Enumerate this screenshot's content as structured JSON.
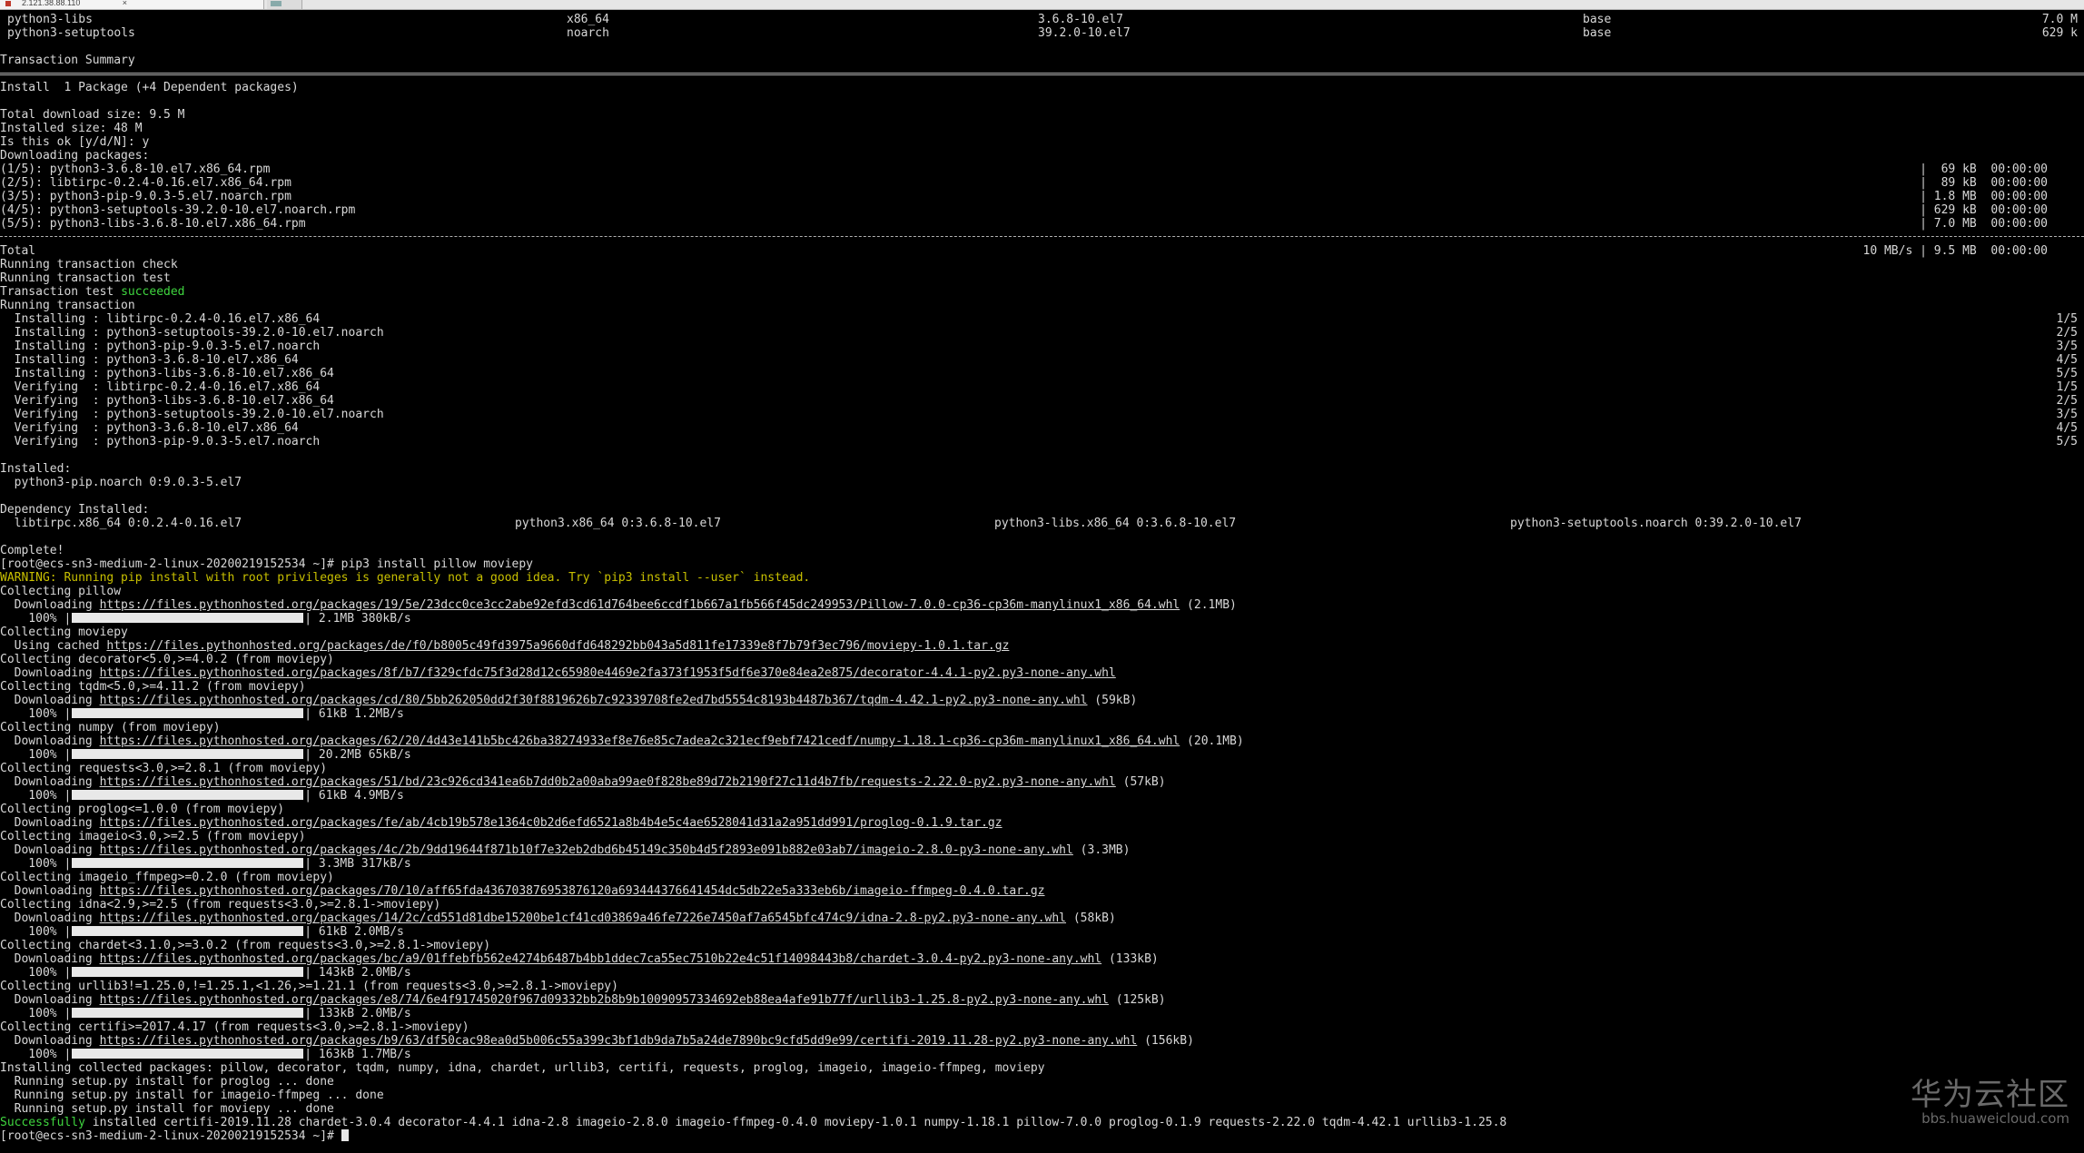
{
  "tabs": [
    {
      "title": "2.121.38.88.110",
      "active": true
    },
    {
      "title": "",
      "active": false
    }
  ],
  "pkg_table": [
    {
      "name": "python3-libs",
      "arch": "x86_64",
      "version": "3.6.8-10.el7",
      "repo": "base",
      "size": "7.0 M"
    },
    {
      "name": "python3-setuptools",
      "arch": "noarch",
      "version": "39.2.0-10.el7",
      "repo": "base",
      "size": "629 k"
    }
  ],
  "summary": {
    "title": "Transaction Summary",
    "install_line": "Install  1 Package (+4 Dependent packages)",
    "download_size": "Total download size: 9.5 M",
    "installed_size": "Installed size: 48 M",
    "prompt": "Is this ok [y/d/N]: y",
    "downloading": "Downloading packages:"
  },
  "downloads": [
    {
      "name": "(1/5): python3-3.6.8-10.el7.x86_64.rpm",
      "stat": "|  69 kB  00:00:00"
    },
    {
      "name": "(2/5): libtirpc-0.2.4-0.16.el7.x86_64.rpm",
      "stat": "|  89 kB  00:00:00"
    },
    {
      "name": "(3/5): python3-pip-9.0.3-5.el7.noarch.rpm",
      "stat": "| 1.8 MB  00:00:00"
    },
    {
      "name": "(4/5): python3-setuptools-39.2.0-10.el7.noarch.rpm",
      "stat": "| 629 kB  00:00:00"
    },
    {
      "name": "(5/5): python3-libs-3.6.8-10.el7.x86_64.rpm",
      "stat": "| 7.0 MB  00:00:00"
    }
  ],
  "total": {
    "label": "Total",
    "stat": "10 MB/s | 9.5 MB  00:00:00"
  },
  "check": [
    "Running transaction check",
    "Running transaction test"
  ],
  "test_prefix": "Transaction test ",
  "test_status": "succeeded",
  "running": "Running transaction",
  "steps": [
    {
      "text": "  Installing : libtirpc-0.2.4-0.16.el7.x86_64",
      "n": "1/5"
    },
    {
      "text": "  Installing : python3-setuptools-39.2.0-10.el7.noarch",
      "n": "2/5"
    },
    {
      "text": "  Installing : python3-pip-9.0.3-5.el7.noarch",
      "n": "3/5"
    },
    {
      "text": "  Installing : python3-3.6.8-10.el7.x86_64",
      "n": "4/5"
    },
    {
      "text": "  Installing : python3-libs-3.6.8-10.el7.x86_64",
      "n": "5/5"
    },
    {
      "text": "  Verifying  : libtirpc-0.2.4-0.16.el7.x86_64",
      "n": "1/5"
    },
    {
      "text": "  Verifying  : python3-libs-3.6.8-10.el7.x86_64",
      "n": "2/5"
    },
    {
      "text": "  Verifying  : python3-setuptools-39.2.0-10.el7.noarch",
      "n": "3/5"
    },
    {
      "text": "  Verifying  : python3-3.6.8-10.el7.x86_64",
      "n": "4/5"
    },
    {
      "text": "  Verifying  : python3-pip-9.0.3-5.el7.noarch",
      "n": "5/5"
    }
  ],
  "installed": {
    "label": "Installed:",
    "item": "  python3-pip.noarch 0:9.0.3-5.el7"
  },
  "deps": {
    "label": "Dependency Installed:",
    "items": [
      "  libtirpc.x86_64 0:0.2.4-0.16.el7",
      "python3.x86_64 0:3.6.8-10.el7",
      "python3-libs.x86_64 0:3.6.8-10.el7",
      "python3-setuptools.noarch 0:39.2.0-10.el7"
    ]
  },
  "complete": "Complete!",
  "prompt1": "[root@ecs-sn3-medium-2-linux-20200219152534 ~]# pip3 install pillow moviepy",
  "warning": "WARNING: Running pip install with root privileges is generally not a good idea. Try `pip3 install --user` instead.",
  "pip_lines": [
    {
      "t": "text",
      "text": "Collecting pillow"
    },
    {
      "t": "dl",
      "prefix": "  Downloading ",
      "url": "https://files.pythonhosted.org/packages/19/5e/23dcc0ce3cc2abe92efd3cd61d764bee6ccdf1b667a1fb566f45dc249953/Pillow-7.0.0-cp36-cp36m-manylinux1_x86_64.whl",
      "suffix": " (2.1MB)"
    },
    {
      "t": "bar",
      "pct": "    100% |",
      "after": "| 2.1MB 380kB/s"
    },
    {
      "t": "text",
      "text": "Collecting moviepy"
    },
    {
      "t": "dl",
      "prefix": "  Using cached ",
      "url": "https://files.pythonhosted.org/packages/de/f0/b8005c49fd3975a9660dfd648292bb043a5d811fe17339e8f7b79f3ec796/moviepy-1.0.1.tar.gz",
      "suffix": ""
    },
    {
      "t": "text",
      "text": "Collecting decorator<5.0,>=4.0.2 (from moviepy)"
    },
    {
      "t": "dl",
      "prefix": "  Downloading ",
      "url": "https://files.pythonhosted.org/packages/8f/b7/f329cfdc75f3d28d12c65980e4469e2fa373f1953f5df6e370e84ea2e875/decorator-4.4.1-py2.py3-none-any.whl",
      "suffix": ""
    },
    {
      "t": "text",
      "text": "Collecting tqdm<5.0,>=4.11.2 (from moviepy)"
    },
    {
      "t": "dl",
      "prefix": "  Downloading ",
      "url": "https://files.pythonhosted.org/packages/cd/80/5bb262050dd2f30f8819626b7c92339708fe2ed7bd5554c8193b4487b367/tqdm-4.42.1-py2.py3-none-any.whl",
      "suffix": " (59kB)"
    },
    {
      "t": "bar",
      "pct": "    100% |",
      "after": "| 61kB 1.2MB/s"
    },
    {
      "t": "text",
      "text": "Collecting numpy (from moviepy)"
    },
    {
      "t": "dl",
      "prefix": "  Downloading ",
      "url": "https://files.pythonhosted.org/packages/62/20/4d43e141b5bc426ba38274933ef8e76e85c7adea2c321ecf9ebf7421cedf/numpy-1.18.1-cp36-cp36m-manylinux1_x86_64.whl",
      "suffix": " (20.1MB)"
    },
    {
      "t": "bar",
      "pct": "    100% |",
      "after": "| 20.2MB 65kB/s"
    },
    {
      "t": "text",
      "text": "Collecting requests<3.0,>=2.8.1 (from moviepy)"
    },
    {
      "t": "dl",
      "prefix": "  Downloading ",
      "url": "https://files.pythonhosted.org/packages/51/bd/23c926cd341ea6b7dd0b2a00aba99ae0f828be89d72b2190f27c11d4b7fb/requests-2.22.0-py2.py3-none-any.whl",
      "suffix": " (57kB)"
    },
    {
      "t": "bar",
      "pct": "    100% |",
      "after": "| 61kB 4.9MB/s"
    },
    {
      "t": "text",
      "text": "Collecting proglog<=1.0.0 (from moviepy)"
    },
    {
      "t": "dl",
      "prefix": "  Downloading ",
      "url": "https://files.pythonhosted.org/packages/fe/ab/4cb19b578e1364c0b2d6efd6521a8b4b4e5c4ae6528041d31a2a951dd991/proglog-0.1.9.tar.gz",
      "suffix": ""
    },
    {
      "t": "text",
      "text": "Collecting imageio<3.0,>=2.5 (from moviepy)"
    },
    {
      "t": "dl",
      "prefix": "  Downloading ",
      "url": "https://files.pythonhosted.org/packages/4c/2b/9dd19644f871b10f7e32eb2dbd6b45149c350b4d5f2893e091b882e03ab7/imageio-2.8.0-py3-none-any.whl",
      "suffix": " (3.3MB)"
    },
    {
      "t": "bar",
      "pct": "    100% |",
      "after": "| 3.3MB 317kB/s"
    },
    {
      "t": "text",
      "text": "Collecting imageio_ffmpeg>=0.2.0 (from moviepy)"
    },
    {
      "t": "dl",
      "prefix": "  Downloading ",
      "url": "https://files.pythonhosted.org/packages/70/10/aff65fda436703876953876120a693444376641454dc5db22e5a333eb6b/imageio-ffmpeg-0.4.0.tar.gz",
      "suffix": ""
    },
    {
      "t": "text",
      "text": "Collecting idna<2.9,>=2.5 (from requests<3.0,>=2.8.1->moviepy)"
    },
    {
      "t": "dl",
      "prefix": "  Downloading ",
      "url": "https://files.pythonhosted.org/packages/14/2c/cd551d81dbe15200be1cf41cd03869a46fe7226e7450af7a6545bfc474c9/idna-2.8-py2.py3-none-any.whl",
      "suffix": " (58kB)"
    },
    {
      "t": "bar",
      "pct": "    100% |",
      "after": "| 61kB 2.0MB/s"
    },
    {
      "t": "text",
      "text": "Collecting chardet<3.1.0,>=3.0.2 (from requests<3.0,>=2.8.1->moviepy)"
    },
    {
      "t": "dl",
      "prefix": "  Downloading ",
      "url": "https://files.pythonhosted.org/packages/bc/a9/01ffebfb562e4274b6487b4bb1ddec7ca55ec7510b22e4c51f14098443b8/chardet-3.0.4-py2.py3-none-any.whl",
      "suffix": " (133kB)"
    },
    {
      "t": "bar",
      "pct": "    100% |",
      "after": "| 143kB 2.0MB/s"
    },
    {
      "t": "text",
      "text": "Collecting urllib3!=1.25.0,!=1.25.1,<1.26,>=1.21.1 (from requests<3.0,>=2.8.1->moviepy)"
    },
    {
      "t": "dl",
      "prefix": "  Downloading ",
      "url": "https://files.pythonhosted.org/packages/e8/74/6e4f91745020f967d09332bb2b8b9b10090957334692eb88ea4afe91b77f/urllib3-1.25.8-py2.py3-none-any.whl",
      "suffix": " (125kB)"
    },
    {
      "t": "bar",
      "pct": "    100% |",
      "after": "| 133kB 2.0MB/s"
    },
    {
      "t": "text",
      "text": "Collecting certifi>=2017.4.17 (from requests<3.0,>=2.8.1->moviepy)"
    },
    {
      "t": "dl",
      "prefix": "  Downloading ",
      "url": "https://files.pythonhosted.org/packages/b9/63/df50cac98ea0d5b006c55a399c3bf1db9da7b5a24de7890bc9cfd5dd9e99/certifi-2019.11.28-py2.py3-none-any.whl",
      "suffix": " (156kB)"
    },
    {
      "t": "bar",
      "pct": "    100% |",
      "after": "| 163kB 1.7MB/s"
    },
    {
      "t": "text",
      "text": "Installing collected packages: pillow, decorator, tqdm, numpy, idna, chardet, urllib3, certifi, requests, proglog, imageio, imageio-ffmpeg, moviepy"
    },
    {
      "t": "text",
      "text": "  Running setup.py install for proglog ... done"
    },
    {
      "t": "text",
      "text": "  Running setup.py install for imageio-ffmpeg ... done"
    },
    {
      "t": "text",
      "text": "  Running setup.py install for moviepy ... done"
    }
  ],
  "success": {
    "word": "Successfully",
    "rest": " installed certifi-2019.11.28 chardet-3.0.4 decorator-4.4.1 idna-2.8 imageio-2.8.0 imageio-ffmpeg-0.4.0 moviepy-1.0.1 numpy-1.18.1 pillow-7.0.0 proglog-0.1.9 requests-2.22.0 tqdm-4.42.1 urllib3-1.25.8"
  },
  "final_prompt": "[root@ecs-sn3-medium-2-linux-20200219152534 ~]# ",
  "watermark": {
    "cn": "华为云社区",
    "en": "bbs.huaweicloud.com"
  },
  "colors": {
    "bg": "#000000",
    "text": "#d8d8d8",
    "success": "#3fd63f",
    "warning": "#c8c000"
  }
}
